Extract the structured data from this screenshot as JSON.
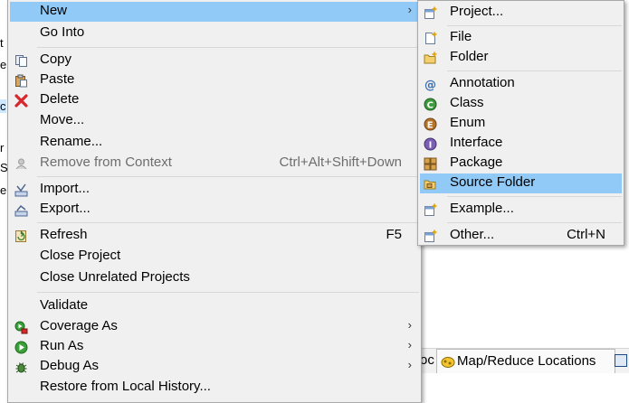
{
  "background": {
    "left_fragments": [
      {
        "text": "t",
        "selected": false
      },
      {
        "text": "e",
        "selected": false
      },
      {
        "text": "c",
        "selected": true
      },
      {
        "text": "r",
        "selected": false
      },
      {
        "text": "S",
        "selected": false
      },
      {
        "text": "e",
        "selected": false
      }
    ],
    "view_tabs": {
      "partial_label": "oc",
      "map_reduce_label": "Map/Reduce Locations"
    }
  },
  "context_menu": {
    "items": [
      {
        "id": "new",
        "label": "New",
        "icon": "none",
        "submenu": true,
        "highlight": true
      },
      {
        "id": "go-into",
        "label": "Go Into",
        "icon": "none"
      },
      {
        "id": "copy",
        "label": "Copy",
        "icon": "copy-icon"
      },
      {
        "id": "paste",
        "label": "Paste",
        "icon": "paste-icon"
      },
      {
        "id": "delete",
        "label": "Delete",
        "icon": "delete-icon"
      },
      {
        "id": "move",
        "label": "Move...",
        "icon": "none"
      },
      {
        "id": "rename",
        "label": "Rename...",
        "icon": "none"
      },
      {
        "id": "remove-from-context",
        "label": "Remove from Context",
        "accel": "Ctrl+Alt+Shift+Down",
        "icon": "remove-context-icon",
        "disabled": true
      },
      {
        "id": "import",
        "label": "Import...",
        "icon": "import-icon"
      },
      {
        "id": "export",
        "label": "Export...",
        "icon": "export-icon"
      },
      {
        "id": "refresh",
        "label": "Refresh",
        "accel": "F5",
        "icon": "refresh-icon"
      },
      {
        "id": "close-project",
        "label": "Close Project",
        "icon": "none"
      },
      {
        "id": "close-unrelated",
        "label": "Close Unrelated Projects",
        "icon": "none"
      },
      {
        "id": "validate",
        "label": "Validate",
        "icon": "none"
      },
      {
        "id": "coverage-as",
        "label": "Coverage As",
        "icon": "coverage-icon",
        "submenu": true
      },
      {
        "id": "run-as",
        "label": "Run As",
        "icon": "run-icon",
        "submenu": true
      },
      {
        "id": "debug-as",
        "label": "Debug As",
        "icon": "debug-icon",
        "submenu": true
      },
      {
        "id": "restore-history",
        "label": "Restore from Local History...",
        "icon": "none"
      }
    ]
  },
  "new_submenu": {
    "items": [
      {
        "id": "project",
        "label": "Project...",
        "icon": "new-project-icon"
      },
      {
        "id": "file",
        "label": "File",
        "icon": "file-icon"
      },
      {
        "id": "folder",
        "label": "Folder",
        "icon": "folder-icon"
      },
      {
        "id": "annotation",
        "label": "Annotation",
        "icon": "annotation-icon"
      },
      {
        "id": "class",
        "label": "Class",
        "icon": "class-icon"
      },
      {
        "id": "enum",
        "label": "Enum",
        "icon": "enum-icon"
      },
      {
        "id": "interface",
        "label": "Interface",
        "icon": "interface-icon"
      },
      {
        "id": "package",
        "label": "Package",
        "icon": "package-icon"
      },
      {
        "id": "source-folder",
        "label": "Source Folder",
        "icon": "source-folder-icon",
        "highlight": true
      },
      {
        "id": "example",
        "label": "Example...",
        "icon": "example-icon"
      },
      {
        "id": "other",
        "label": "Other...",
        "accel": "Ctrl+N",
        "icon": "other-icon"
      }
    ]
  },
  "colors": {
    "menu_bg": "#f0f0f0",
    "highlight": "#91c9f7",
    "disabled_text": "#6d6d6d"
  }
}
